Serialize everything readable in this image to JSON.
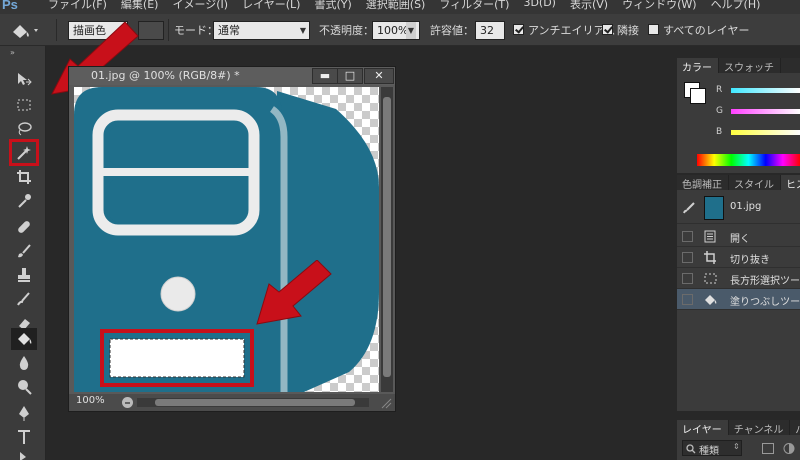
{
  "menubar": {
    "logo": "Ps",
    "items": [
      "ファイル(F)",
      "編集(E)",
      "イメージ(I)",
      "レイヤー(L)",
      "書式(Y)",
      "選択範囲(S)",
      "フィルター(T)",
      "3D(D)",
      "表示(V)",
      "ウィンドウ(W)",
      "ヘルプ(H)"
    ]
  },
  "options": {
    "fill_source": "描画色",
    "mode_label": "モード：",
    "mode_value": "通常",
    "opacity_label": "不透明度：",
    "opacity_value": "100%",
    "tolerance_label": "許容値：",
    "tolerance_value": "32",
    "antialias_label": "アンチエイリアス",
    "contiguous_label": "隣接",
    "all_layers_label": "すべてのレイヤー"
  },
  "document": {
    "title": "01.jpg @ 100% (RGB/8#) *",
    "zoom": "100%",
    "minimize": "▬",
    "restore": "□",
    "close": "✕"
  },
  "color_panel": {
    "tabs": [
      "カラー",
      "スウォッチ"
    ],
    "channels": [
      "R",
      "G",
      "B"
    ]
  },
  "history_panel": {
    "tabs": [
      "色調補正",
      "スタイル",
      "ヒス"
    ],
    "snapshot": "01.jpg",
    "items": [
      "開く",
      "切り抜き",
      "長方形選択ツー",
      "塗りつぶしツール"
    ]
  },
  "layers_panel": {
    "tabs": [
      "レイヤー",
      "チャンネル",
      "パス"
    ],
    "filter_label": "種類"
  },
  "colors": {
    "drive_blue": "#1f6f8b",
    "annotation_red": "#c8101a"
  }
}
